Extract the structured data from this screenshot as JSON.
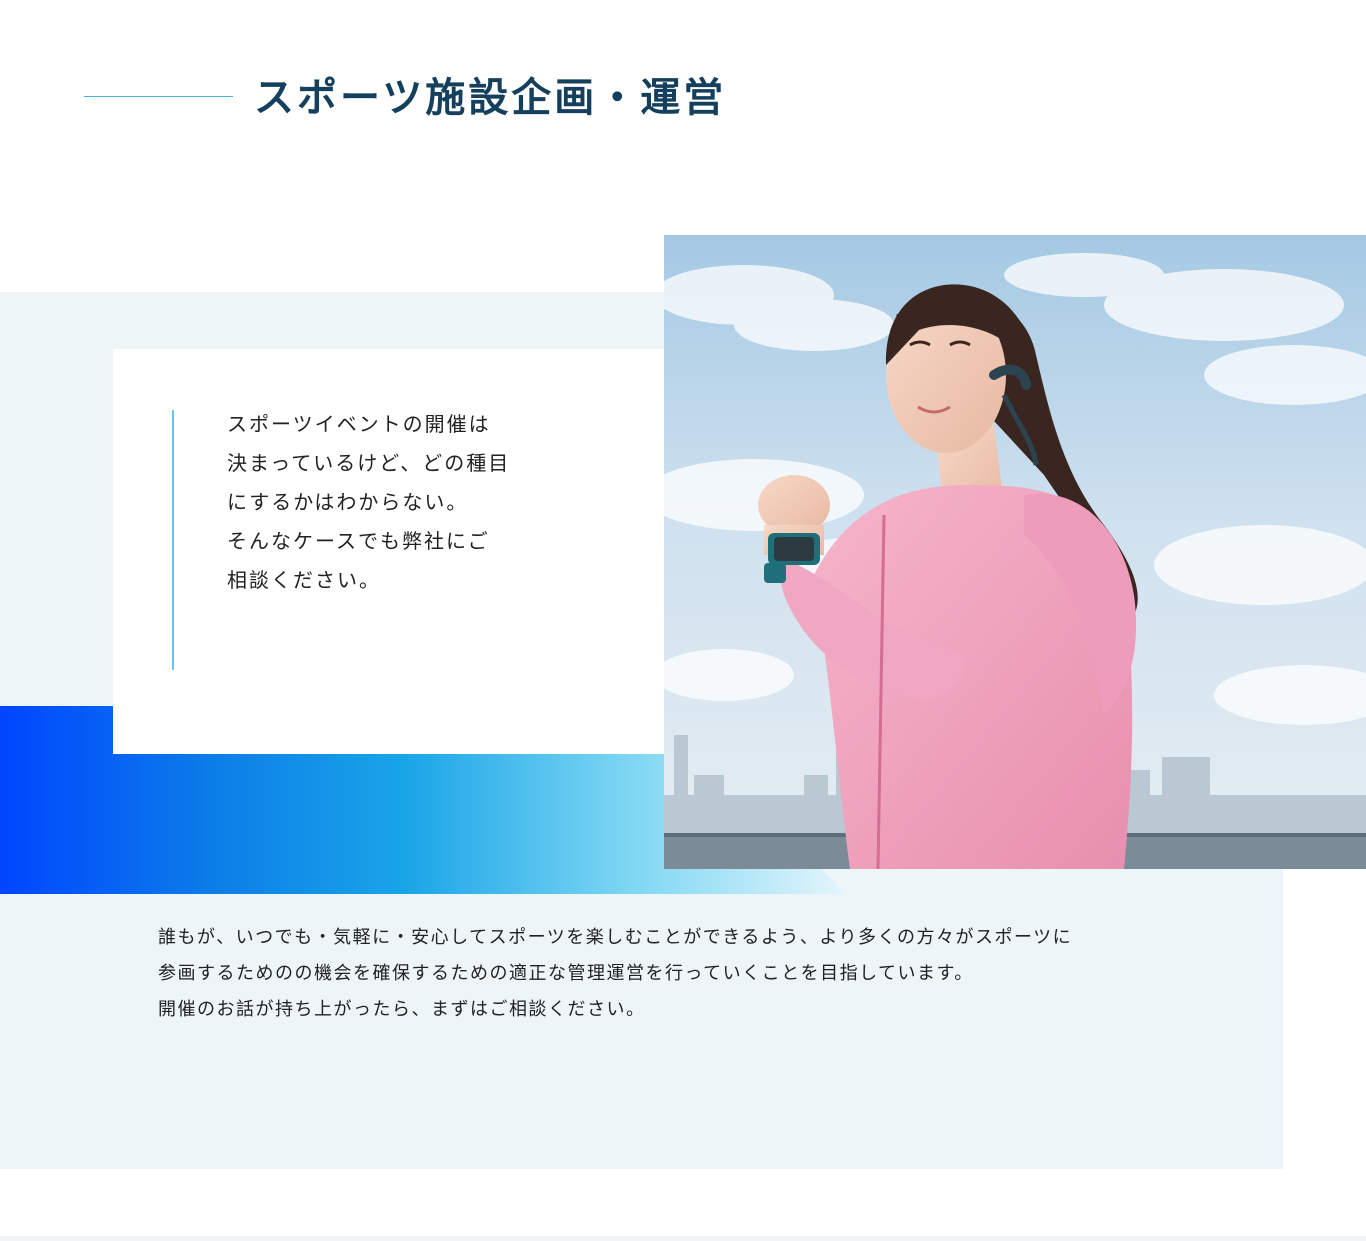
{
  "heading": {
    "title": "スポーツ施設企画・運営"
  },
  "card": {
    "lines": [
      "スポーツイベントの開催は",
      "決まっているけど、どの種目",
      "にするかはわからない。",
      "そんなケースでも弊社にご",
      "相談ください。"
    ]
  },
  "photo": {
    "subject": "woman-jogging-photo"
  },
  "body": {
    "lines": [
      "誰もが、いつでも・気軽に・安心してスポーツを楽しむことができるよう、より多くの方々がスポーツに",
      "参画するためのの機会を確保するための適正な管理運営を行っていくことを目指しています。",
      "開催のお話が持ち上がったら、まずはご相談ください。"
    ]
  },
  "colors": {
    "heading": "#14405e",
    "accent_line": "#4cb2d8",
    "panel_bg": "#edf5f9",
    "gradient_start": "#0045ff",
    "gradient_end": "#e4f6fc"
  }
}
